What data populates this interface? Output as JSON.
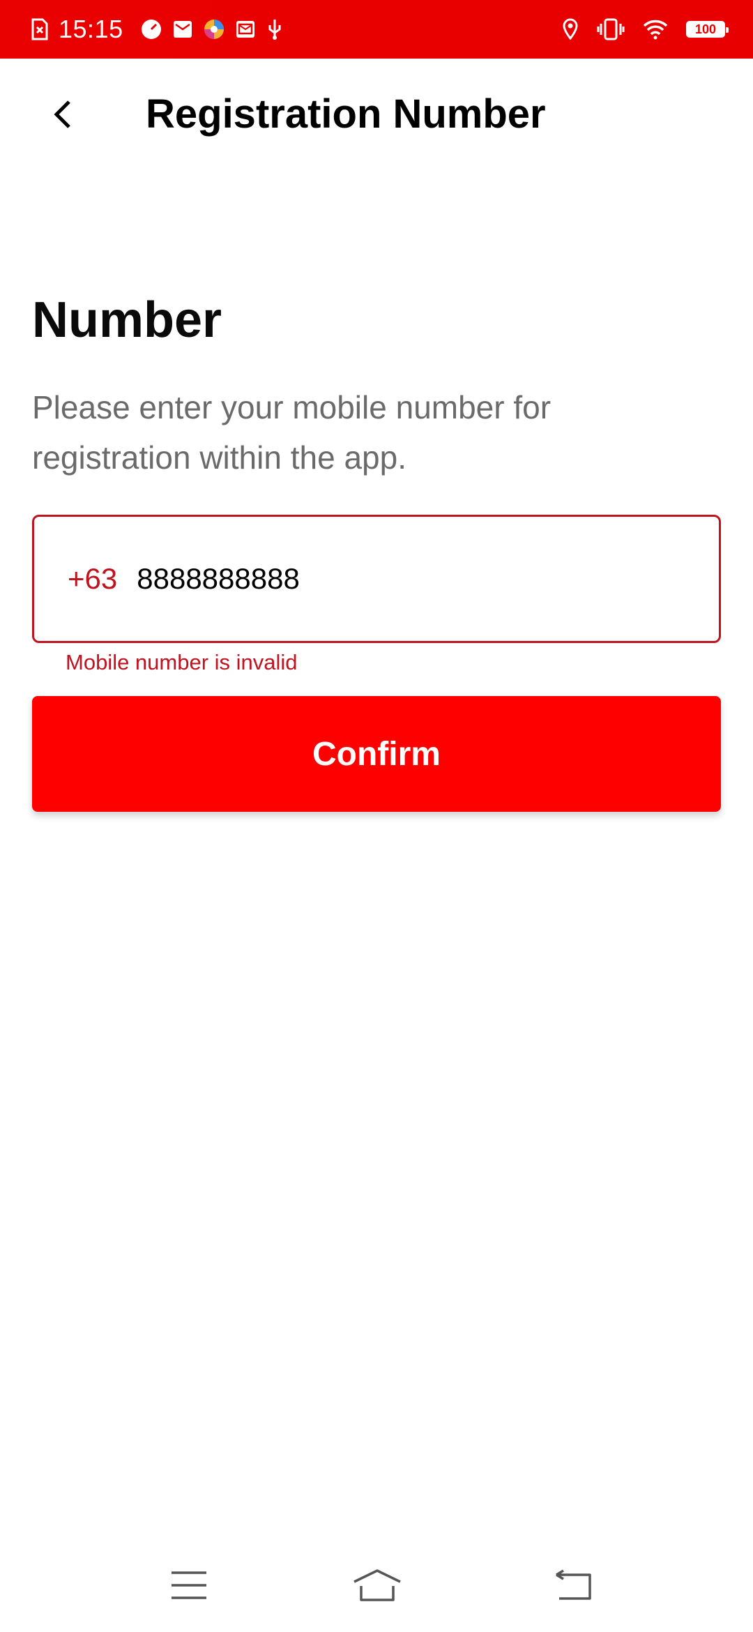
{
  "status_bar": {
    "time": "15:15",
    "battery": "100",
    "left_icons": [
      "sim-error-icon",
      "speed-icon",
      "mail-icon",
      "browser-icon",
      "email-icon",
      "usb-icon"
    ],
    "right_icons": [
      "location-icon",
      "vibrate-icon",
      "wifi-icon",
      "battery-icon"
    ],
    "bg_color": "#e80000"
  },
  "app_bar": {
    "title": "Registration Number"
  },
  "content": {
    "heading": "Number",
    "description": "Please enter your mobile number for registration within the app.",
    "country_code": "+63",
    "phone_value": "8888888888",
    "error": "Mobile number is invalid",
    "confirm_label": "Confirm"
  },
  "colors": {
    "accent": "#ff0000",
    "error": "#c0121f"
  },
  "nav_bar": {
    "icons": [
      "menu-icon",
      "home-icon",
      "back-nav-icon"
    ]
  }
}
